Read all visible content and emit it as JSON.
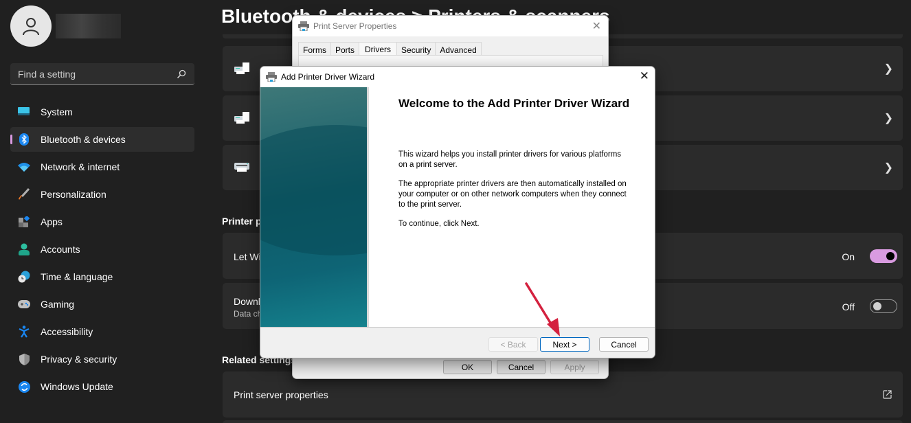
{
  "sidebar": {
    "user_name_hidden": "",
    "search": {
      "placeholder": "Find a setting",
      "value": ""
    },
    "items": [
      {
        "label": "System",
        "icon": "system-icon",
        "active": false
      },
      {
        "label": "Bluetooth & devices",
        "icon": "bluetooth-icon",
        "active": true
      },
      {
        "label": "Network & internet",
        "icon": "wifi-icon",
        "active": false
      },
      {
        "label": "Personalization",
        "icon": "brush-icon",
        "active": false
      },
      {
        "label": "Apps",
        "icon": "apps-icon",
        "active": false
      },
      {
        "label": "Accounts",
        "icon": "account-icon",
        "active": false
      },
      {
        "label": "Time & language",
        "icon": "time-language-icon",
        "active": false
      },
      {
        "label": "Gaming",
        "icon": "gamepad-icon",
        "active": false
      },
      {
        "label": "Accessibility",
        "icon": "accessibility-icon",
        "active": false
      },
      {
        "label": "Privacy & security",
        "icon": "shield-icon",
        "active": false
      },
      {
        "label": "Windows Update",
        "icon": "update-icon",
        "active": false
      }
    ]
  },
  "main": {
    "title": "Bluetooth & devices  >  Printers & scanners",
    "printer_preferences_heading": "Printer preferences",
    "let_windows_label": "Let Windows manage my default printer",
    "let_windows_state": "On",
    "download_label": "Download drivers and device software over metered connections",
    "download_sub": "Data charges may apply",
    "download_state": "Off",
    "related_heading": "Related settings",
    "print_server_label": "Print server properties",
    "accent_color": "#d99be0"
  },
  "print_server_dialog": {
    "title": "Print Server Properties",
    "tabs": [
      "Forms",
      "Ports",
      "Drivers",
      "Security",
      "Advanced"
    ],
    "active_tab": "Drivers",
    "buttons": {
      "ok": "OK",
      "cancel": "Cancel",
      "apply": "Apply"
    }
  },
  "wizard": {
    "title": "Add Printer Driver Wizard",
    "heading": "Welcome to the Add Printer Driver Wizard",
    "paragraph1": "This wizard helps you install printer drivers for various platforms on a print server.",
    "paragraph2": "The appropriate printer drivers are then automatically installed on your computer or on other network computers when they connect to the print server.",
    "paragraph3": "To continue, click Next.",
    "buttons": {
      "back": "< Back",
      "next": "Next >",
      "cancel": "Cancel"
    },
    "annotation_arrow_color": "#d4213f"
  }
}
